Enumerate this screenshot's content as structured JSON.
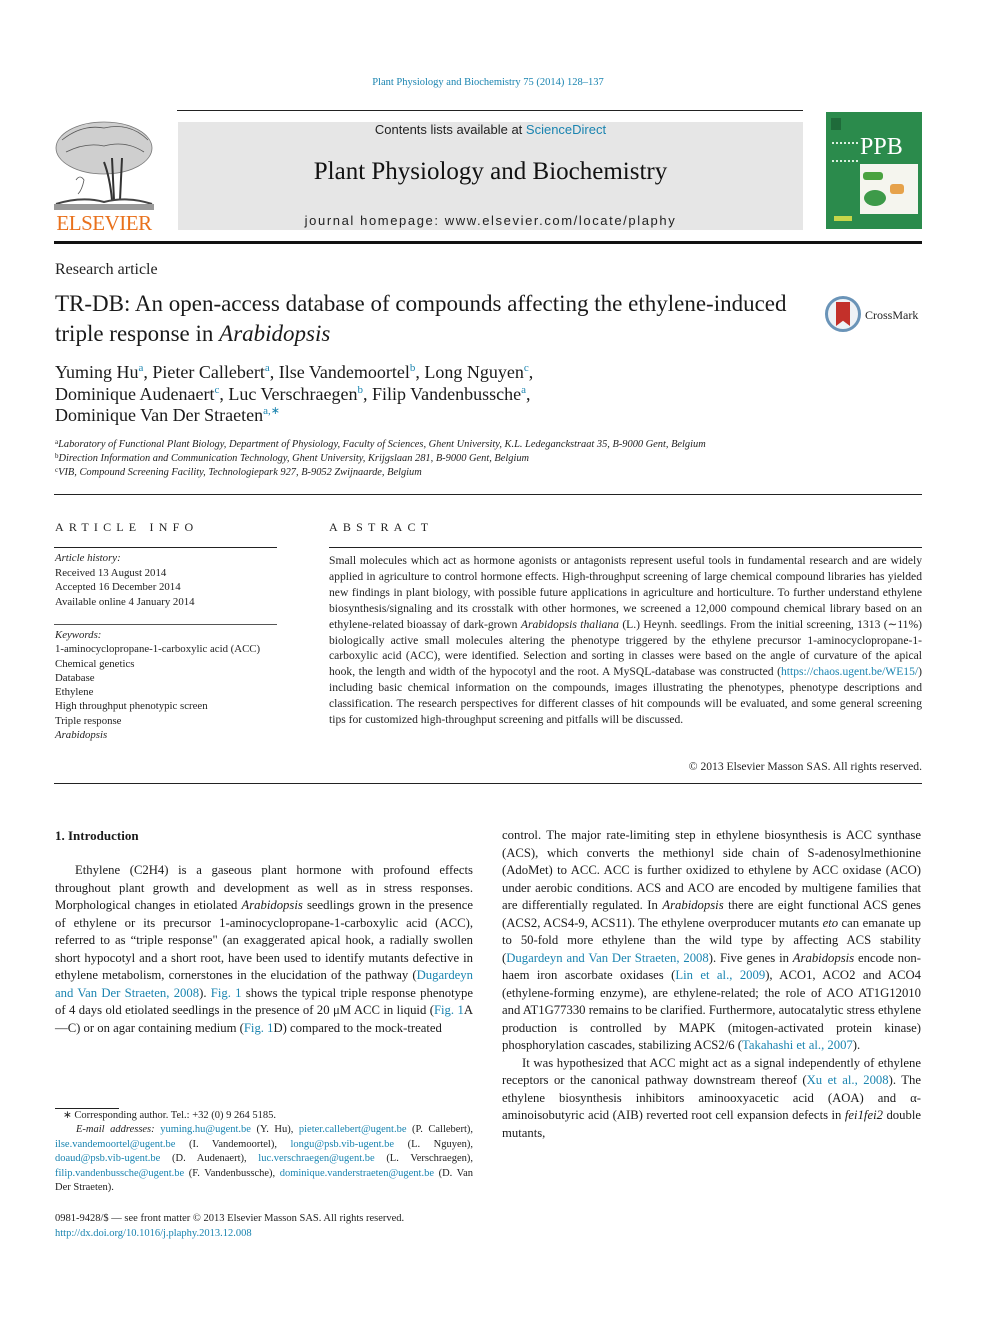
{
  "header": {
    "citation": "Plant Physiology and Biochemistry 75 (2014) 128–137",
    "contents_prefix": "Contents lists available at ",
    "contents_link": "ScienceDirect",
    "journal_title": "Plant Physiology and Biochemistry",
    "homepage": "journal homepage: www.elsevier.com/locate/plaphy",
    "publisher_logo": "ELSEVIER",
    "cover_label": "PPB",
    "crossmark_label": "CrossMark"
  },
  "article": {
    "type": "Research article",
    "title_plain": "TR-DB: An open-access database of compounds affecting the ethylene-induced triple response in ",
    "title_italic": "Arabidopsis",
    "authors": [
      {
        "name": "Yuming Hu",
        "aff": "a",
        "sep": ", "
      },
      {
        "name": "Pieter Callebert",
        "aff": "a",
        "sep": ", "
      },
      {
        "name": "Ilse Vandemoortel",
        "aff": "b",
        "sep": ", "
      },
      {
        "name": "Long Nguyen",
        "aff": "c",
        "sep": ","
      },
      {
        "name": "Dominique Audenaert",
        "aff": "c",
        "sep": ", "
      },
      {
        "name": "Luc Verschraegen",
        "aff": "b",
        "sep": ", "
      },
      {
        "name": "Filip Vandenbussche",
        "aff": "a",
        "sep": ","
      },
      {
        "name": "Dominique Van Der Straeten",
        "aff": "a,∗",
        "sep": ""
      }
    ],
    "affiliations": [
      {
        "key": "a",
        "text": "Laboratory of Functional Plant Biology, Department of Physiology, Faculty of Sciences, Ghent University, K.L. Ledeganckstraat 35, B-9000 Gent, Belgium"
      },
      {
        "key": "b",
        "text": "Direction Information and Communication Technology, Ghent University, Krijgslaan 281, B-9000 Gent, Belgium"
      },
      {
        "key": "c",
        "text": "VIB, Compound Screening Facility, Technologiepark 927, B-9052 Zwijnaarde, Belgium"
      }
    ]
  },
  "article_info": {
    "heading": "ARTICLE INFO",
    "history_label": "Article history:",
    "history": [
      "Received 13 August 2014",
      "Accepted 16 December 2014",
      "Available online 4 January 2014"
    ],
    "keywords_label": "Keywords:",
    "keywords": [
      "1-aminocyclopropane-1-carboxylic acid (ACC)",
      "Chemical genetics",
      "Database",
      "Ethylene",
      "High throughput phenotypic screen",
      "Triple response"
    ],
    "keyword_italic": "Arabidopsis"
  },
  "abstract": {
    "heading": "ABSTRACT",
    "part1": "Small molecules which act as hormone agonists or antagonists represent useful tools in fundamental research and are widely applied in agriculture to control hormone effects. High-throughput screening of large chemical compound libraries has yielded new findings in plant biology, with possible future applications in agriculture and horticulture. To further understand ethylene biosynthesis/signaling and its crosstalk with other hormones, we screened a 12,000 compound chemical library based on an ethylene-related bioassay of dark-grown ",
    "italic1": "Arabidopsis thaliana",
    "part2": " (L.) Heynh. seedlings. From the initial screening, 1313 (∼11%) biologically active small molecules altering the phenotype triggered by the ethylene precursor 1-aminocyclopropane-1-carboxylic acid (ACC), were identified. Selection and sorting in classes were based on the angle of curvature of the apical hook, the length and width of the hypocotyl and the root. A MySQL-database was constructed (",
    "link": "https://chaos.ugent.be/WE15/",
    "part3": ") including basic chemical information on the compounds, images illustrating the phenotypes, phenotype descriptions and classification. The research perspectives for different classes of hit compounds will be evaluated, and some general screening tips for customized high-throughput screening and pitfalls will be discussed.",
    "copyright": "© 2013 Elsevier Masson SAS. All rights reserved."
  },
  "intro": {
    "heading": "1.  Introduction",
    "left": {
      "t1": "Ethylene (C2H4) is a gaseous plant hormone with profound effects throughout plant growth and development as well as in stress responses. Morphological changes in etiolated ",
      "i1": "Arabidopsis",
      "t2": " seedlings grown in the presence of ethylene or its precursor 1-aminocyclopropane-1-carboxylic acid (ACC), referred to as “triple response\" (an exaggerated apical hook, a radially swollen short hypocotyl and a short root, have been used to identify mutants defective in ethylene metabolism, cornerstones in the elucidation of the pathway (",
      "ref1": "Dugardeyn and Van Der Straeten, 2008",
      "t3": "). ",
      "ref2": "Fig. 1",
      "t4": " shows the typical triple response phenotype of 4 days old etiolated seedlings in the presence of 20 μM ACC in liquid (",
      "ref3": "Fig. 1",
      "t5": "A—C) or on agar containing medium (",
      "ref4": "Fig. 1",
      "t6": "D) compared to the mock-treated"
    },
    "right": {
      "t1": "control. The major rate-limiting step in ethylene biosynthesis is ACC synthase (ACS), which converts the methionyl side chain of S-adenosylmethionine (AdoMet) to ACC. ACC is further oxidized to ethylene by ACC oxidase (ACO) under aerobic conditions. ACS and ACO are encoded by multigene families that are differentially regulated. In ",
      "i1": "Arabidopsis",
      "t2": " there are eight functional ACS genes (ACS2, ACS4-9, ACS11). The ethylene overproducer mutants ",
      "i2": "eto",
      "t3": " can emanate up to 50-fold more ethylene than the wild type by affecting ACS stability (",
      "ref1": "Dugardeyn and Van Der Straeten, 2008",
      "t4": "). Five genes in ",
      "i3": "Arabidopsis",
      "t5": " encode non-haem iron ascorbate oxidases (",
      "ref2": "Lin et al., 2009",
      "t6": "), ACO1, ACO2 and ACO4 (ethylene-forming enzyme), are ethylene-related; the role of ACO AT1G12010 and AT1G77330 remains to be clarified. Furthermore, autocatalytic stress ethylene production is controlled by MAPK (mitogen-activated protein kinase) phosphorylation cascades, stabilizing ACS2/6 (",
      "ref3": "Takahashi et al., 2007",
      "t7": ").",
      "p2_t1": "It was hypothesized that ACC might act as a signal independently of ethylene receptors or the canonical pathway downstream thereof (",
      "p2_ref1": "Xu et al., 2008",
      "p2_t2": "). The ethylene biosynthesis inhibitors aminooxyacetic acid (AOA) and α-aminoisobutyric acid (AIB) reverted root cell expansion defects in ",
      "p2_i1": "fei1fei2",
      "p2_t3": " double mutants,"
    }
  },
  "footnote": {
    "corresponding": "∗ Corresponding author. Tel.: +32 (0) 9 264 5185.",
    "email_label": "E-mail addresses:",
    "emails": [
      {
        "email": "yuming.hu@ugent.be",
        "who": " (Y. Hu), "
      },
      {
        "email": "pieter.callebert@ugent.be",
        "who": " (P. Callebert), "
      },
      {
        "email": "ilse.vandemoortel@ugent.be",
        "who": " (I. Vandemoortel), "
      },
      {
        "email": "longu@psb.vib-ugent.be",
        "who": " (L. Nguyen), "
      },
      {
        "email": "doaud@psb.vib-ugent.be",
        "who": " (D. Audenaert), "
      },
      {
        "email": "luc.verschraegen@ugent.be",
        "who": " (L. Verschraegen), "
      },
      {
        "email": "filip.vandenbussche@ugent.be",
        "who": " (F. Vandenbussche), "
      },
      {
        "email": "dominique.vanderstraeten@ugent.be",
        "who": " (D. Van Der Straeten)."
      }
    ]
  },
  "front_matter": {
    "issn": "0981-9428/$ — see front matter © 2013 Elsevier Masson SAS. All rights reserved.",
    "doi": "http://dx.doi.org/10.1016/j.plaphy.2013.12.008"
  },
  "colors": {
    "link": "#1a84b0",
    "elsevier_orange": "#e9711c",
    "cover_green": "#2b8b4c",
    "header_box": "#e6e6e6"
  }
}
